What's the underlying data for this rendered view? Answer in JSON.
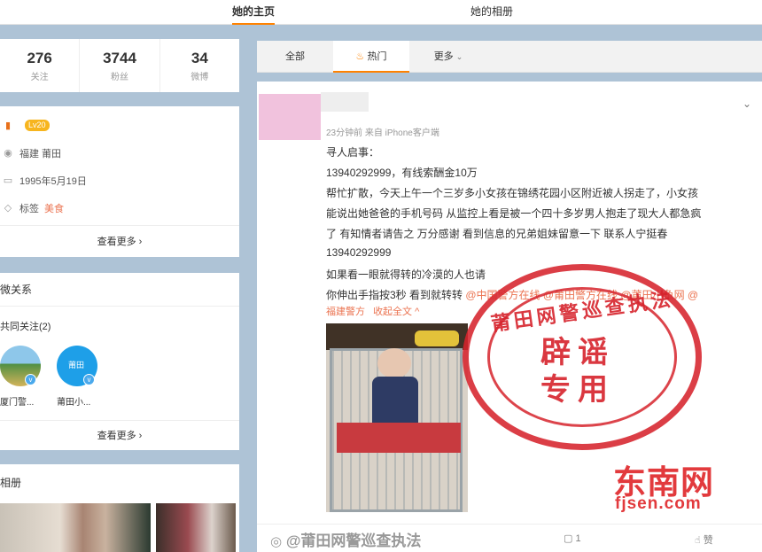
{
  "tabs": {
    "home": "她的主页",
    "album": "她的相册"
  },
  "stats": [
    {
      "value": "276",
      "label": "关注"
    },
    {
      "value": "3744",
      "label": "粉丝"
    },
    {
      "value": "34",
      "label": "微博"
    }
  ],
  "info": {
    "level": "Lv20",
    "location": "福建 莆田",
    "birthday": "1995年5月19日",
    "tag_label": "标签",
    "tag_value": "美食",
    "more": "查看更多 ›"
  },
  "relations": {
    "title": "微关系",
    "common_follow": "共同关注(2)",
    "users": [
      {
        "name": "厦门警..."
      },
      {
        "name": "莆田小..."
      }
    ],
    "avatar2_text": "莆田",
    "more": "查看更多 ›"
  },
  "album": {
    "title": "相册"
  },
  "feed_tabs": {
    "all": "全部",
    "hot": "热门",
    "more": "更多"
  },
  "post": {
    "meta": "23分钟前 来自 iPhone客户端",
    "lines": [
      "寻人启事：",
      "13940292999，有线索酬金10万",
      "帮忙扩散，今天上午一个三岁多小女孩在锦绣花园小区附近被人拐走了，小女孩",
      "能说出她爸爸的手机号码 从监控上看是被一个四十多岁男人抱走了现大人都急疯",
      "了 有知情者请告之 万分感谢 看到信息的兄弟姐妹留意一下 联系人宁挺春",
      "13940292999",
      "如果看一眼就得转的冷漠的人也请",
      "你伸出手指按3秒 看到就转转"
    ],
    "mentions_line1": "@中国警方在线 @莆田警方在线 @莆田小鱼网 @",
    "mention_line2": "福建警方",
    "collapse": "收起全文 ^",
    "comment_count": "1",
    "like_label": "赞"
  },
  "stamp": {
    "ring_text": "莆田网警巡查执法",
    "line1": "辟谣",
    "line2": "专用"
  },
  "watermark": {
    "logo": "东南网",
    "url": "fjsen.com",
    "weibo": "@莆田网警巡查执法"
  },
  "colors": {
    "accent": "#ff8200",
    "link": "#eb7350",
    "stamp": "#d6232c",
    "background": "#aec3d6"
  }
}
